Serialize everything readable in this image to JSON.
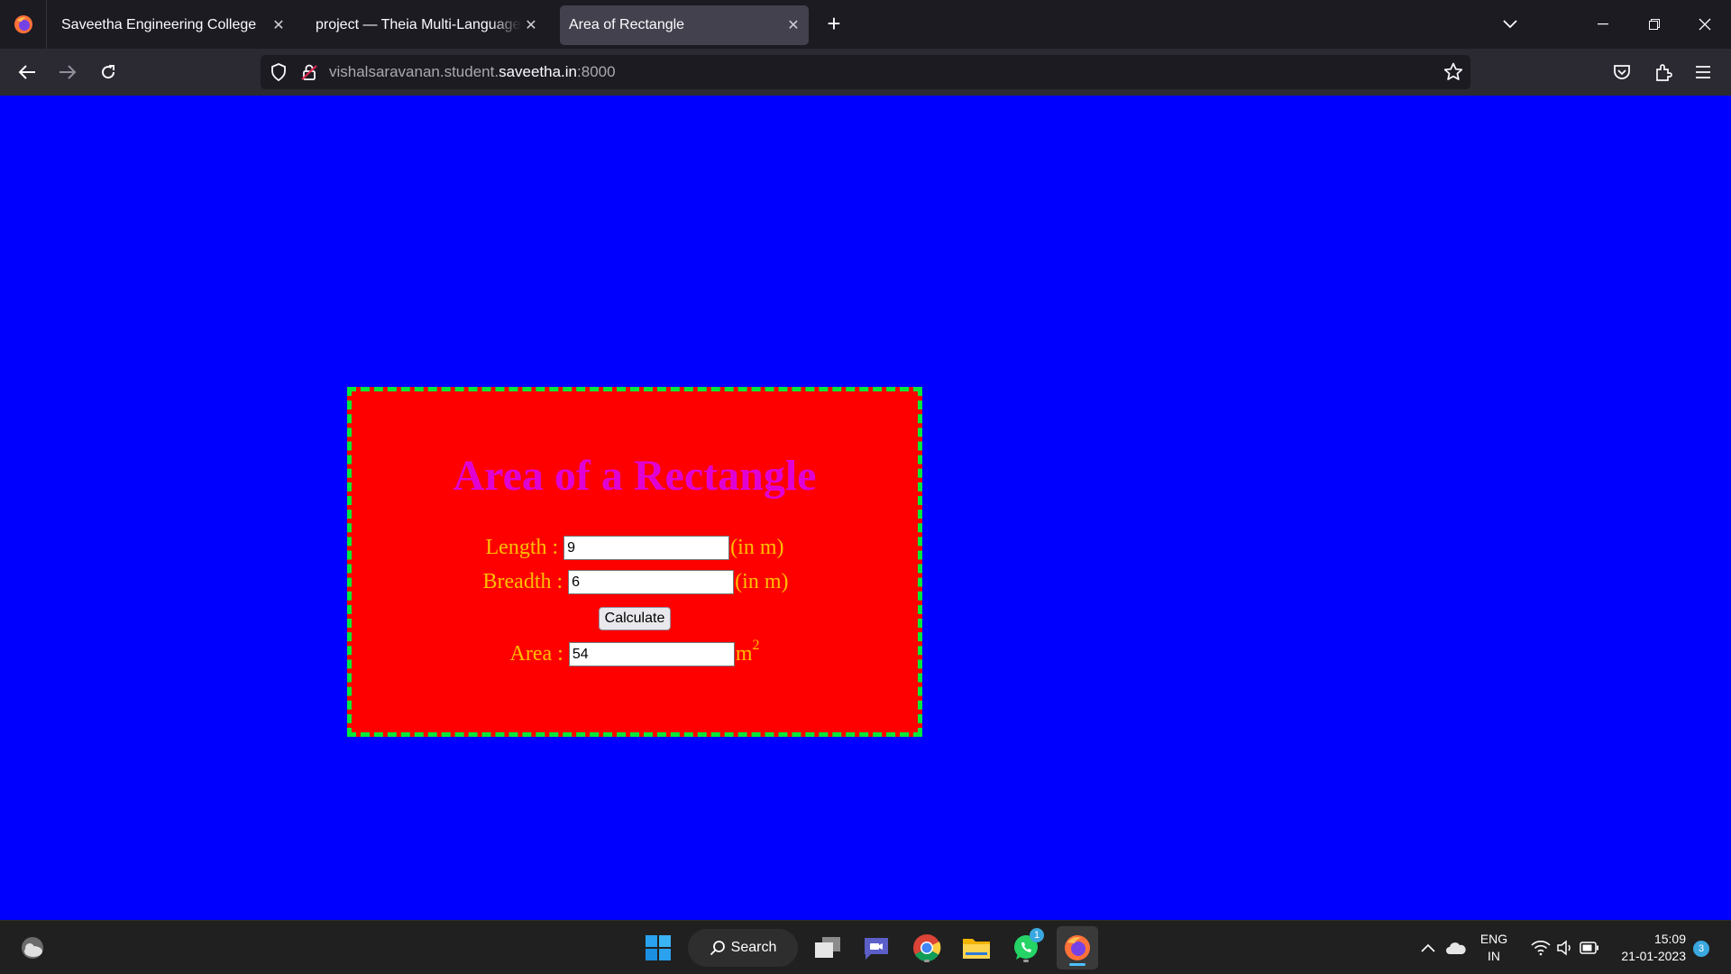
{
  "browser": {
    "tabs": [
      {
        "title": "Saveetha Engineering College"
      },
      {
        "title": "project — Theia Multi-Language Explorer"
      },
      {
        "title": "Area of Rectangle"
      }
    ],
    "url": {
      "prefix": "vishalsaravanan.student.",
      "domain": "saveetha.in",
      "suffix": ":8000"
    }
  },
  "page": {
    "heading": "Area of a Rectangle",
    "length": {
      "label": "Length :",
      "value": "9",
      "unit": "(in m)"
    },
    "breadth": {
      "label": "Breadth :",
      "value": "6",
      "unit": "(in m)"
    },
    "calculate_label": "Calculate",
    "area": {
      "label": "Area :",
      "value": "54",
      "unit_base": "m",
      "unit_exp": "2"
    },
    "colors": {
      "background": "#0000ff",
      "card": "#ff0000",
      "border": "#00e83a",
      "heading": "#e000d4",
      "text": "#ffbf00"
    }
  },
  "taskbar": {
    "search_label": "Search",
    "whatsapp_badge": "1",
    "lang_line1": "ENG",
    "lang_line2": "IN",
    "time": "15:09",
    "date": "21-01-2023",
    "notification_count": "3"
  }
}
